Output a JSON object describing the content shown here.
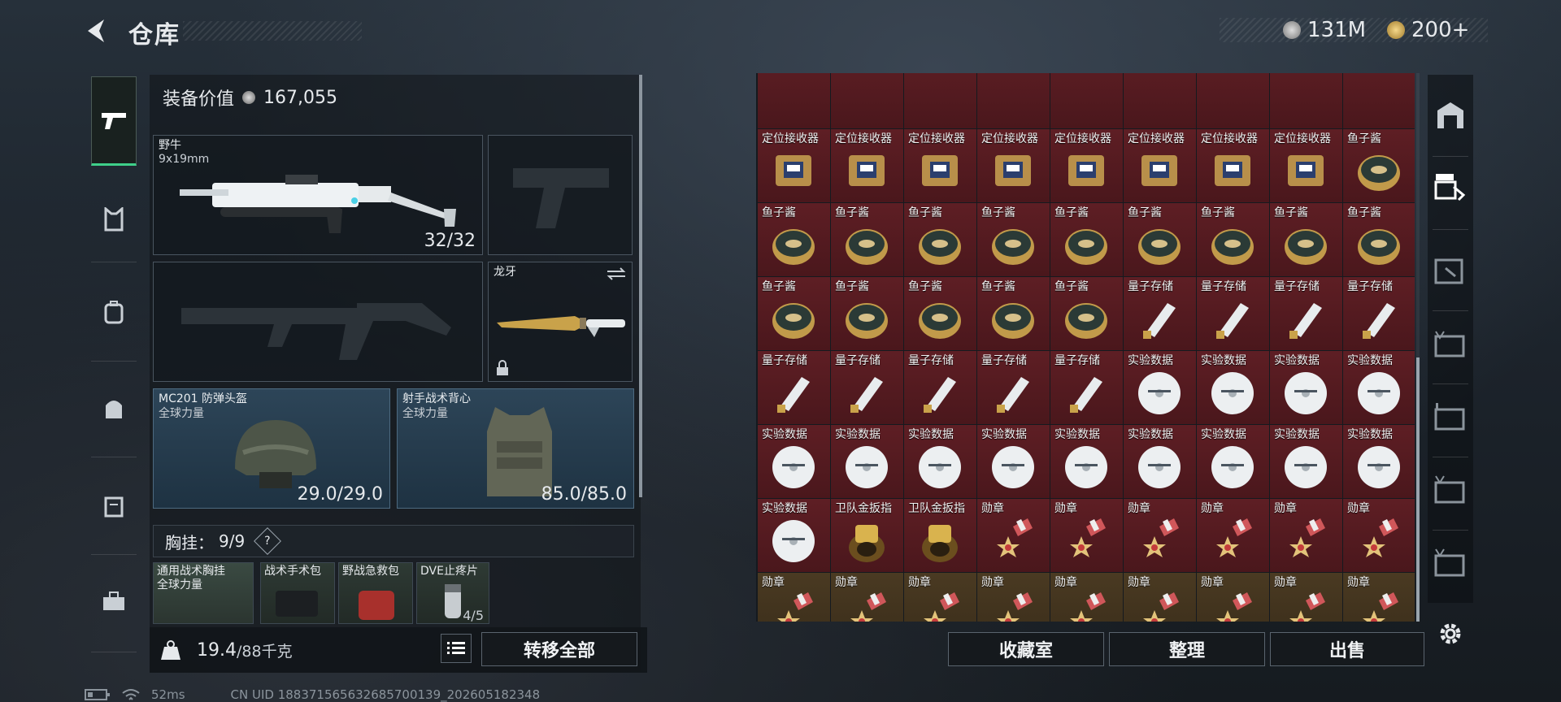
{
  "header": {
    "title": "仓库",
    "currency_silver": "131M",
    "currency_gold": "200+"
  },
  "equipment": {
    "value_label": "装备价值",
    "value": "167,055",
    "primary_weapon": {
      "name": "野牛",
      "caliber": "9x19mm",
      "ammo": "32/32"
    },
    "melee": {
      "name": "龙牙"
    },
    "helmet": {
      "name": "MC201 防弹头盔",
      "faction": "全球力量",
      "durability": "29.0/29.0"
    },
    "armor": {
      "name": "射手战术背心",
      "faction": "全球力量",
      "durability": "85.0/85.0"
    },
    "chest": {
      "label": "胸挂：",
      "count": "9/9",
      "help": "?"
    },
    "chest_items": [
      {
        "name": "通用战术胸挂",
        "faction": "全球力量"
      },
      {
        "name": "战术手术包"
      },
      {
        "name": "野战急救包"
      },
      {
        "name": "DVE止疼片",
        "qty": "4/5"
      }
    ],
    "weight": "19.4",
    "weight_max": "/88千克",
    "transfer_all": "转移全部"
  },
  "status": {
    "ping": "52ms",
    "uid": "CN UID 188371565632685700139_202605182348"
  },
  "inventory": {
    "items": [
      "定位接收器",
      "定位接收器",
      "定位接收器",
      "定位接收器",
      "定位接收器",
      "定位接收器",
      "定位接收器",
      "定位接收器",
      "鱼子酱",
      "鱼子酱",
      "鱼子酱",
      "鱼子酱",
      "鱼子酱",
      "鱼子酱",
      "鱼子酱",
      "鱼子酱",
      "鱼子酱",
      "鱼子酱",
      "鱼子酱",
      "鱼子酱",
      "鱼子酱",
      "鱼子酱",
      "鱼子酱",
      "量子存储",
      "量子存储",
      "量子存储",
      "量子存储",
      "量子存储",
      "量子存储",
      "量子存储",
      "量子存储",
      "量子存储",
      "实验数据",
      "实验数据",
      "实验数据",
      "实验数据",
      "实验数据",
      "实验数据",
      "实验数据",
      "实验数据",
      "实验数据",
      "实验数据",
      "实验数据",
      "实验数据",
      "实验数据",
      "实验数据",
      "卫队金扳指",
      "卫队金扳指",
      "勋章",
      "勋章",
      "勋章",
      "勋章",
      "勋章",
      "勋章",
      "勋章",
      "勋章",
      "勋章",
      "勋章",
      "勋章",
      "勋章",
      "勋章",
      "勋章",
      "勋章"
    ],
    "buttons": {
      "collection": "收藏室",
      "sort": "整理",
      "sell": "出售"
    }
  },
  "colors": {
    "accent": "#3fd08a",
    "cell_red": "#5e1e24",
    "slot_blue": "#2d4558"
  }
}
